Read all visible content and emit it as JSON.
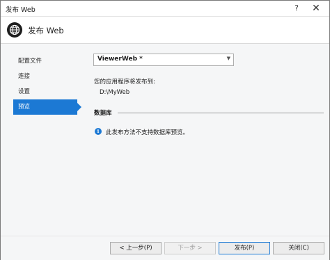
{
  "window": {
    "title": "发布 Web"
  },
  "titlebar": {
    "help_glyph": "?",
    "close_glyph": "✕"
  },
  "header": {
    "icon": "globe-icon",
    "title": "发布 Web"
  },
  "nav": {
    "items": [
      {
        "label": "配置文件",
        "active": false
      },
      {
        "label": "连接",
        "active": false
      },
      {
        "label": "设置",
        "active": false
      },
      {
        "label": "预览",
        "active": true
      }
    ]
  },
  "profile": {
    "selected": "ViewerWeb *",
    "arrow_icon": "chevron-down-icon"
  },
  "publish": {
    "label": "您的应用程序将发布到:",
    "path": "D:\\MyWeb"
  },
  "database": {
    "heading": "数据库",
    "info_icon": "info-icon",
    "message": "此发布方法不支持数据库预览。"
  },
  "buttons": {
    "prev": "< 上一步(P)",
    "next": "下一步 >",
    "publish": "发布(P)",
    "close": "关闭(C)"
  },
  "colors": {
    "accent": "#1c79d4"
  }
}
